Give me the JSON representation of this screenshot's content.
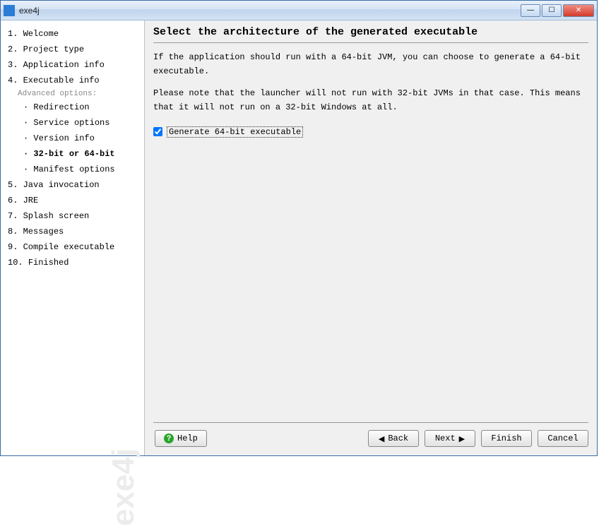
{
  "window": {
    "title": "exe4j"
  },
  "sidebar": {
    "items": [
      {
        "num": "1.",
        "label": "Welcome"
      },
      {
        "num": "2.",
        "label": "Project type"
      },
      {
        "num": "3.",
        "label": "Application info"
      },
      {
        "num": "4.",
        "label": "Executable info"
      }
    ],
    "advanced_header": "Advanced options:",
    "sub_items": [
      {
        "bullet": "·",
        "label": "Redirection"
      },
      {
        "bullet": "·",
        "label": "Service options"
      },
      {
        "bullet": "·",
        "label": "Version info"
      },
      {
        "bullet": "·",
        "label": "32-bit or 64-bit",
        "active": true
      },
      {
        "bullet": "·",
        "label": "Manifest options"
      }
    ],
    "items2": [
      {
        "num": "5.",
        "label": "Java invocation"
      },
      {
        "num": "6.",
        "label": "JRE"
      },
      {
        "num": "7.",
        "label": "Splash screen"
      },
      {
        "num": "8.",
        "label": "Messages"
      },
      {
        "num": "9.",
        "label": "Compile executable"
      },
      {
        "num": "10.",
        "label": "Finished"
      }
    ],
    "watermark": "exe4j"
  },
  "main": {
    "heading": "Select the architecture of the generated executable",
    "para1": "If the application should run with a 64-bit JVM, you can choose to generate a 64-bit executable.",
    "para2": "Please note that the launcher will not run with 32-bit JVMs in that case. This means that it will not run on a 32-bit Windows at all.",
    "checkbox_label": "Generate 64-bit executable",
    "checkbox_checked": true
  },
  "footer": {
    "help": "Help",
    "back": "Back",
    "next": "Next",
    "finish": "Finish",
    "cancel": "Cancel"
  }
}
